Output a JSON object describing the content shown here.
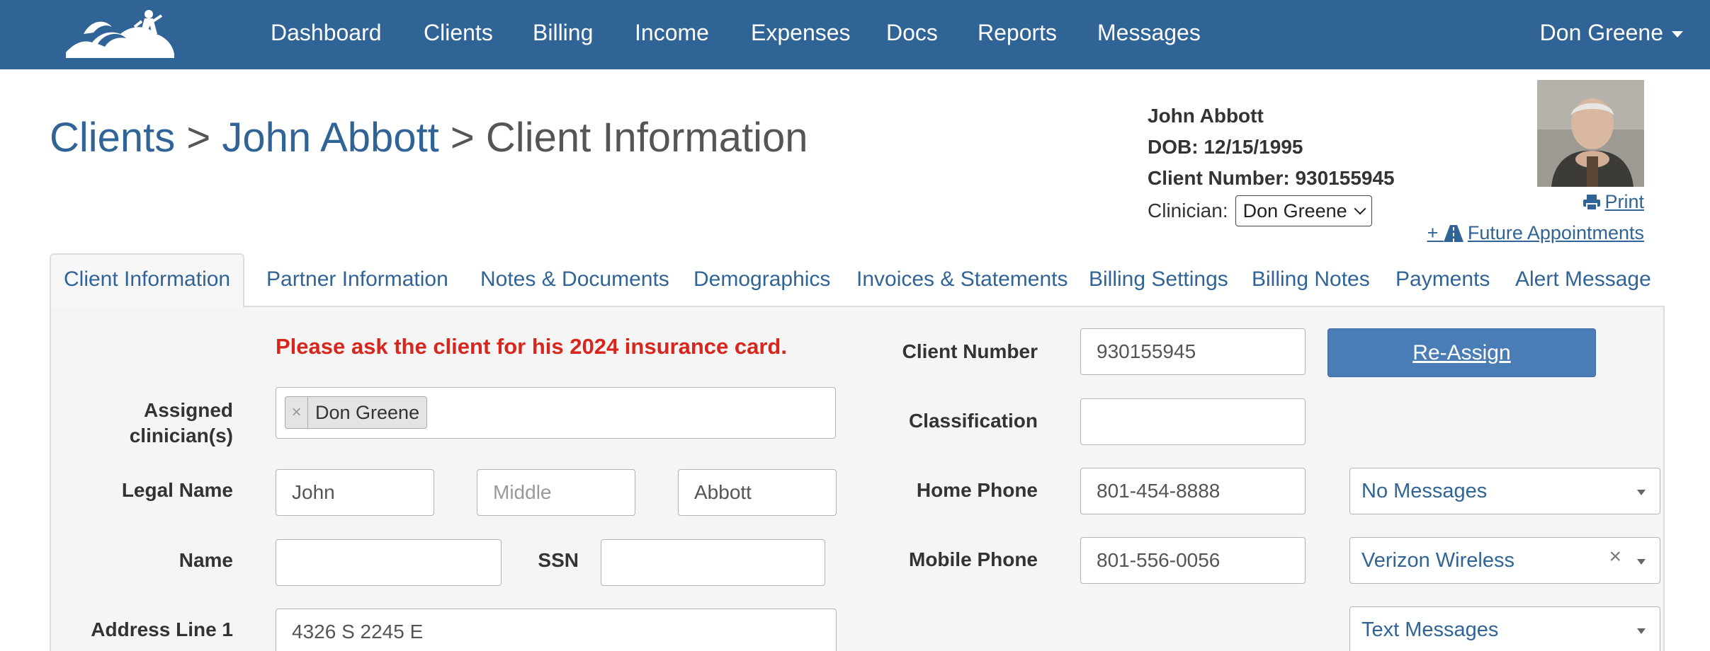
{
  "nav": {
    "items": [
      "Dashboard",
      "Clients",
      "Billing",
      "Income",
      "Expenses",
      "Docs",
      "Reports",
      "Messages"
    ],
    "user": "Don Greene"
  },
  "breadcrumb": {
    "clients": "Clients",
    "sep1": ">",
    "client": "John Abbott",
    "sep2": ">",
    "current": "Client Information"
  },
  "summary": {
    "name": "John Abbott",
    "dob": "DOB: 12/15/1995",
    "client_number": "Client Number: 930155945",
    "clinician_label": "Clinician:",
    "clinician_value": "Don Greene",
    "print_label": "Print",
    "future_label": "Future Appointments"
  },
  "tabs": [
    "Client Information",
    "Partner Information",
    "Notes & Documents",
    "Demographics",
    "Invoices & Statements",
    "Billing Settings",
    "Billing Notes",
    "Payments",
    "Alert Message"
  ],
  "form": {
    "alert": "Please ask the client for his 2024 insurance card.",
    "assigned_label_1": "Assigned",
    "assigned_label_2": "clinician(s)",
    "assigned_tag": "Don Greene",
    "legal_name_label": "Legal Name",
    "first_name": "John",
    "middle_placeholder": "Middle",
    "last_name": "Abbott",
    "name_label": "Name",
    "name_value": "",
    "ssn_label": "SSN",
    "ssn_value": "",
    "address1_label": "Address Line 1",
    "address1": "4326 S 2245 E",
    "client_number_label": "Client Number",
    "client_number": "930155945",
    "reassign_label": "Re-Assign",
    "classification_label": "Classification",
    "classification": "",
    "home_phone_label": "Home Phone",
    "home_phone": "801-454-8888",
    "home_phone_option": "No Messages",
    "mobile_phone_label": "Mobile Phone",
    "mobile_phone": "801-556-0056",
    "mobile_carrier": "Verizon Wireless",
    "mobile_option": "Text Messages"
  },
  "colors": {
    "navbar": "#316496",
    "link": "#316496",
    "alert": "#d9261c",
    "button": "#4a7db5"
  }
}
